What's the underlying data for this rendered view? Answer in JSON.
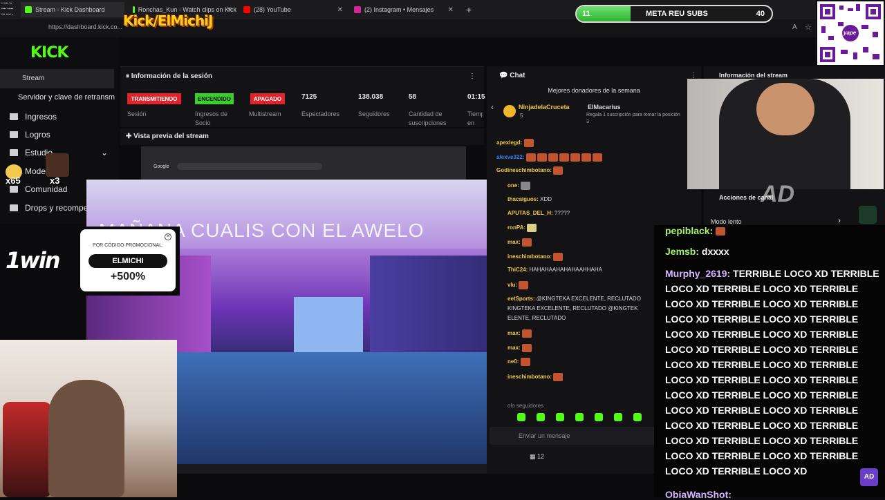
{
  "browser": {
    "tabs": [
      {
        "label": "Stream - Kick Dashboard"
      },
      {
        "label": "Ronchas_Kun - Watch clips on Kick"
      },
      {
        "label": "(28) YouTube"
      },
      {
        "label": "(2) Instagram • Mensajes"
      }
    ],
    "new_tab": "+",
    "url": "https://dashboard.kick.co..."
  },
  "overlay": {
    "channel_banner": "Kick/ElMichiJ",
    "meta": {
      "start": "11",
      "label": "META REU SUBS",
      "end": "40",
      "progress_fraction": 0.275
    },
    "qr_caption": "yape"
  },
  "kick": {
    "logo": "KICK",
    "nav": {
      "stream": "Stream",
      "stream_key": "Servidor y clave de retransm",
      "items": [
        "Ingresos",
        "Logros",
        "Estudio",
        "Mode",
        "Comunidad",
        "Drops y recompe"
      ]
    },
    "badges": {
      "count_a": "x65",
      "count_b": "x3"
    },
    "session": {
      "title": "Información de la sesión",
      "statuses": [
        {
          "badge": "TRANSMITIENDO",
          "label": "Sesión",
          "color": "#e0242a"
        },
        {
          "badge": "ENCENDIDO",
          "label": "Ingresos de Socio",
          "color": "#39d02e"
        },
        {
          "badge": "APAGADO",
          "label": "Multistream",
          "color": "#e0242a"
        }
      ],
      "stats": [
        {
          "value": "7125",
          "label": "Espectadores"
        },
        {
          "value": "138.038",
          "label": "Seguidores"
        },
        {
          "value": "58",
          "label": "Cantidad de suscripciones"
        },
        {
          "value": "01:15",
          "label": "Tiemp en viv"
        }
      ]
    },
    "preview_title": "Vista previa del stream",
    "chat": {
      "title": "Chat",
      "donors_title": "Mejores donadores de la semana",
      "donor_1": "NinjadelaCruceta",
      "donor_1_count": "5",
      "donor_2": "ElMacarius",
      "donor_2_note": "Regala 1 suscripción para tomar la posición 3",
      "lines": [
        {
          "user": "apexlegd:",
          "text": ""
        },
        {
          "user": "alexve322:",
          "text": ""
        },
        {
          "user": "Godineschimbotano:",
          "text": ""
        },
        {
          "user": "one:",
          "text": ""
        },
        {
          "user": "thacaiguos:",
          "text": "XDD"
        },
        {
          "user": "APUTAS_DEL_H:",
          "text": "?????"
        },
        {
          "user": "ronPA:",
          "text": ""
        },
        {
          "user": "max:",
          "text": ""
        },
        {
          "user": "ineschimbotano:",
          "text": ""
        },
        {
          "user": "ThiC24:",
          "text": "HAHAHAAHAHAHAAHHAHA"
        },
        {
          "user": "vlu:",
          "text": ""
        },
        {
          "user": "eetSports:",
          "text": "@KINGTEKA EXCELENTE, RECLUTADO"
        },
        {
          "user": "",
          "text": "KINGTEKA EXCELENTE, RECLUTADO @KINGTEK"
        },
        {
          "user": "",
          "text": "ELENTE, RECLUTADO"
        },
        {
          "user": "max:",
          "text": ""
        },
        {
          "user": "max:",
          "text": ""
        },
        {
          "user": "ne0:",
          "text": ""
        },
        {
          "user": "ineschimbotano:",
          "text": ""
        },
        {
          "user": "",
          "text": "olo seguidores"
        }
      ],
      "input_placeholder": "Enviar un mensaje",
      "footer_count": "12"
    },
    "stream_info_title": "Información del stream",
    "actions_title": "Acciones de canal",
    "slow_mode": "Modo lento"
  },
  "video": {
    "caption": "MAÑANA CUALIS CON EL AWELO",
    "browser_search": "Google"
  },
  "promo": {
    "brand": "1win",
    "caption": "POR CÓDIGO PROMOCIONAL:",
    "code": "ELMICHI",
    "bonus": "+500%"
  },
  "overlay_chat": {
    "lines": [
      {
        "user": "pepiblack:",
        "text": ""
      },
      {
        "user": "Jemsb:",
        "text": "dxxxx"
      },
      {
        "user": "Murphy_2619:",
        "text": "TERRIBLE LOCO XD TERRIBLE"
      },
      {
        "user": "",
        "text": "LOCO XD TERRIBLE LOCO XD TERRIBLE"
      },
      {
        "user": "",
        "text": "LOCO XD TERRIBLE LOCO XD TERRIBLE"
      },
      {
        "user": "",
        "text": "LOCO XD TERRIBLE LOCO XD TERRIBLE"
      },
      {
        "user": "",
        "text": "LOCO XD TERRIBLE LOCO XD TERRIBLE"
      },
      {
        "user": "",
        "text": "LOCO XD TERRIBLE LOCO XD TERRIBLE"
      },
      {
        "user": "",
        "text": "LOCO XD TERRIBLE LOCO XD TERRIBLE"
      },
      {
        "user": "",
        "text": "LOCO XD TERRIBLE LOCO XD TERRIBLE"
      },
      {
        "user": "",
        "text": "LOCO XD TERRIBLE LOCO XD TERRIBLE"
      },
      {
        "user": "",
        "text": "LOCO XD TERRIBLE LOCO XD TERRIBLE"
      },
      {
        "user": "",
        "text": "LOCO XD TERRIBLE LOCO XD TERRIBLE"
      },
      {
        "user": "",
        "text": "LOCO XD TERRIBLE LOCO XD TERRIBLE"
      },
      {
        "user": "",
        "text": "LOCO XD TERRIBLE LOCO XD TERRIBLE"
      },
      {
        "user": "",
        "text": "LOCO XD TERRIBLE LOCO XD"
      },
      {
        "user": "ObiaWanShot:",
        "text": ""
      }
    ],
    "watermark": "AD",
    "logo": "AD"
  },
  "colors": {
    "kick_green": "#53fc18",
    "live_red": "#e0242a",
    "panel": "#131316"
  }
}
